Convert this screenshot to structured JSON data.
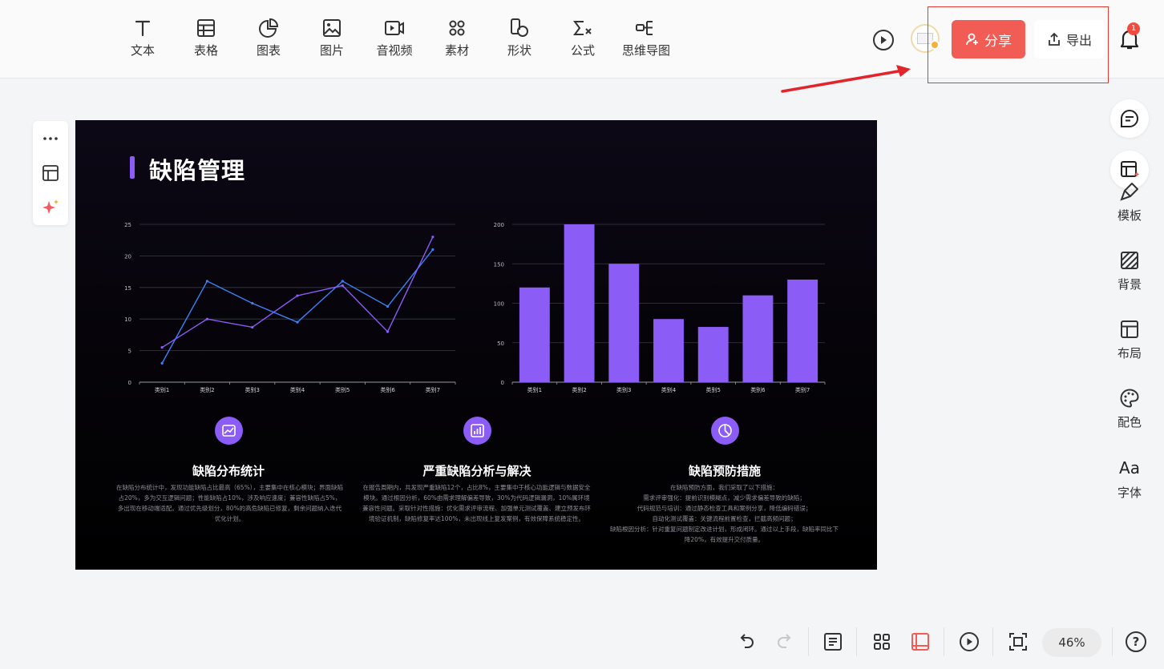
{
  "toolbar": {
    "items": [
      {
        "label": "文本",
        "icon": "text-icon"
      },
      {
        "label": "表格",
        "icon": "table-icon"
      },
      {
        "label": "图表",
        "icon": "chart-icon"
      },
      {
        "label": "图片",
        "icon": "image-icon"
      },
      {
        "label": "音视频",
        "icon": "video-icon"
      },
      {
        "label": "素材",
        "icon": "assets-icon"
      },
      {
        "label": "形状",
        "icon": "shape-icon"
      },
      {
        "label": "公式",
        "icon": "formula-icon"
      },
      {
        "label": "思维导图",
        "icon": "mindmap-icon"
      }
    ],
    "share_label": "分享",
    "export_label": "导出",
    "notification_count": "1"
  },
  "colors": {
    "accent": "#8b5cf6",
    "share": "#f15d55",
    "line_blue": "#3b82f6",
    "line_purple": "#8b5cf6"
  },
  "slide": {
    "title": "缺陷管理",
    "features": [
      {
        "icon": "line-chart-icon",
        "title": "缺陷分布统计",
        "text": "在缺陷分布统计中，发现功能缺陷占比最高（65%），主要集中在核心模块；界面缺陷占20%，多为交互逻辑问题；性能缺陷占10%，涉及响应速度；兼容性缺陷占5%，多出现在移动端适配。通过优先级划分，80%的高危缺陷已修复，剩余问题纳入迭代优化计划。"
      },
      {
        "icon": "bar-chart-icon",
        "title": "严重缺陷分析与解决",
        "text": "在报告周期内，共发现严重缺陷12个，占比8%，主要集中于核心功能逻辑与数据安全模块。通过根因分析，60%由需求理解偏差导致，30%为代码逻辑漏洞，10%属环境兼容性问题。采取针对性措施：优化需求评审流程、加强单元测试覆盖、建立预发布环境验证机制，缺陷修复率达100%，未出现线上复发案例，有效保障系统稳定性。"
      },
      {
        "icon": "pie-chart-icon",
        "title": "缺陷预防措施",
        "text": "在缺陷预防方面，我们采取了以下措施：\n需求评审强化：提前识别模糊点，减少需求偏差导致的缺陷；\n代码规范与培训：通过静态检查工具和案例分享，降低编码错误；\n自动化测试覆盖：关键流程前置检查，拦截高频问题；\n缺陷根因分析：针对重复问题制定改进计划，形成闭环。通过以上手段，缺陷率同比下降20%，有效提升交付质量。"
      }
    ]
  },
  "chart_data": [
    {
      "type": "line",
      "categories": [
        "类别1",
        "类别2",
        "类别3",
        "类别4",
        "类别5",
        "类别6",
        "类别7"
      ],
      "ylim": [
        0,
        25
      ],
      "yticks": [
        "0",
        "5",
        "10",
        "15",
        "20",
        "25"
      ],
      "grid": true,
      "series": [
        {
          "color": "#3b82f6",
          "values": [
            3,
            16,
            12.5,
            9.5,
            16,
            12,
            21
          ]
        },
        {
          "color": "#8b5cf6",
          "values": [
            5.5,
            10,
            8.7,
            13.7,
            15.3,
            8,
            23
          ]
        }
      ]
    },
    {
      "type": "bar",
      "categories": [
        "类别1",
        "类别2",
        "类别3",
        "类别4",
        "类别5",
        "类别6",
        "类别7"
      ],
      "values": [
        120,
        200,
        150,
        80,
        70,
        110,
        130
      ],
      "ylim": [
        0,
        200
      ],
      "yticks": [
        "0",
        "50",
        "100",
        "150",
        "200"
      ],
      "grid": true,
      "color": "#8b5cf6"
    }
  ],
  "right_panel": {
    "items": [
      {
        "label": "模板",
        "icon": "template-icon"
      },
      {
        "label": "背景",
        "icon": "background-icon"
      },
      {
        "label": "布局",
        "icon": "layout-icon"
      },
      {
        "label": "配色",
        "icon": "palette-icon"
      },
      {
        "label": "字体",
        "icon": "font-icon",
        "glyph": "Aa"
      }
    ]
  },
  "bottom_bar": {
    "zoom": "46%",
    "help": "?"
  }
}
